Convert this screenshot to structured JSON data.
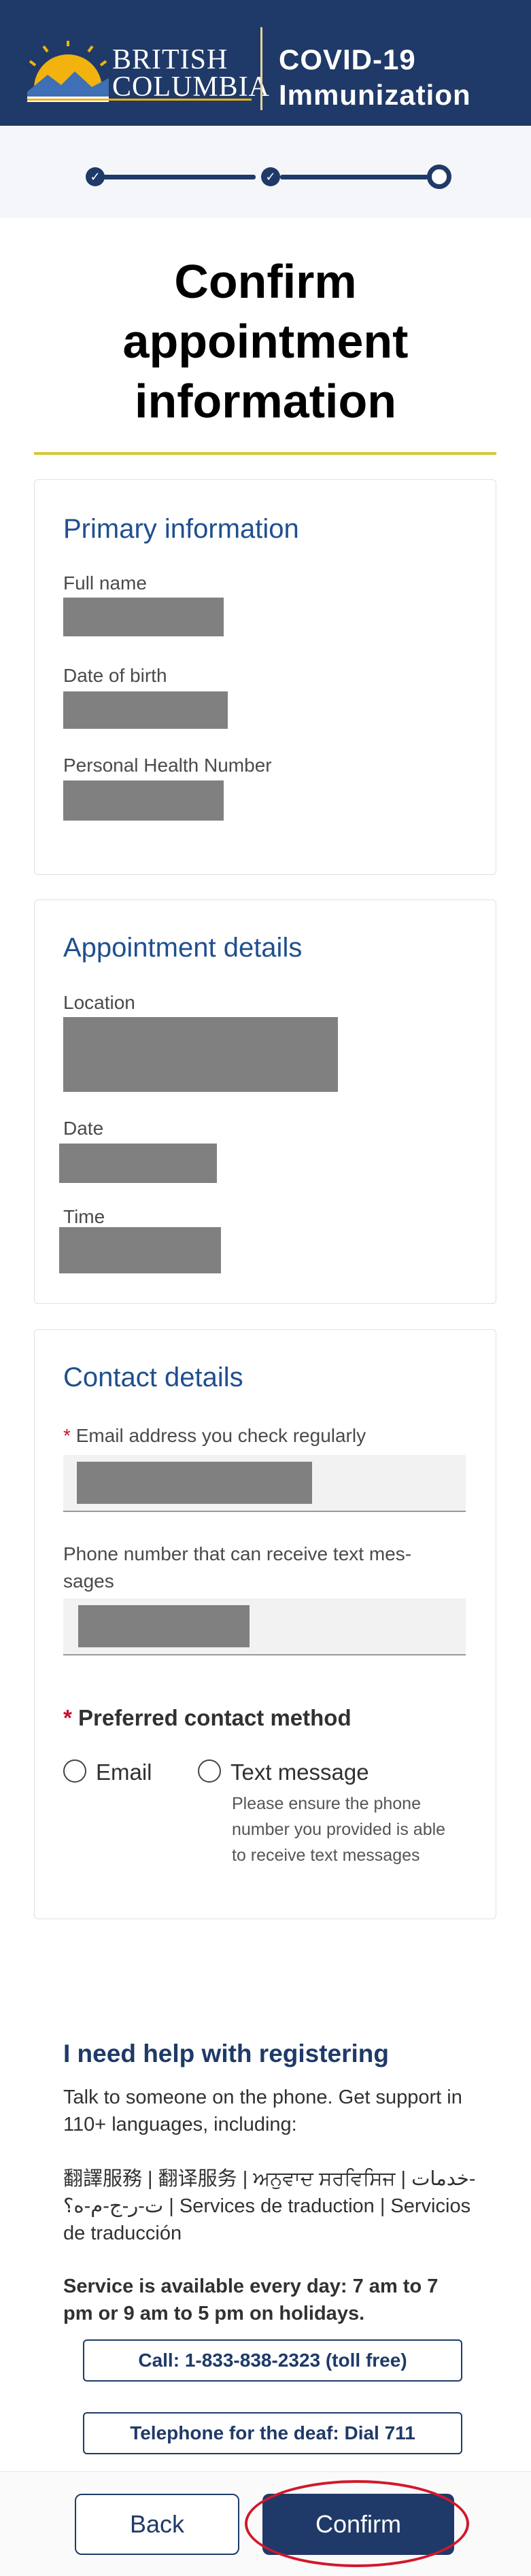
{
  "header": {
    "logo_line1": "BRITISH",
    "logo_line2": "COLUMBIA",
    "title_line1": "COVID-19",
    "title_line2": "Immunization"
  },
  "stepper": {
    "steps_total": 3,
    "current_step": 3,
    "done_icon": "check-icon"
  },
  "page": {
    "title_line1": "Confirm",
    "title_line2": "appointment",
    "title_line3": "information"
  },
  "primary": {
    "title": "Primary information",
    "full_name_label": "Full name",
    "dob_label": "Date of birth",
    "phn_label": "Personal Health Number"
  },
  "appointment": {
    "title": "Appointment details",
    "location_label": "Location",
    "date_label": "Date",
    "time_label": "Time"
  },
  "contact": {
    "title": "Contact details",
    "required_marker": "*",
    "email_label": "Email address you check regularly",
    "phone_label_line1": "Phone number that can receive text mes-",
    "phone_label_line2": "sages",
    "preferred_label": "Preferred contact method",
    "option_email": "Email",
    "option_text": "Text message",
    "text_hint_line1": "Please ensure the phone",
    "text_hint_line2": "number you provided is able",
    "text_hint_line3": "to receive text messages"
  },
  "help": {
    "title": "I need help with registering",
    "intro_line1": "Talk to someone on the phone. Get support in",
    "intro_line2": "110+ languages, including:",
    "languages_line1": "翻譯服務 | 翻译服务 | ਅਨੁਵਾਦ ਸਰਵਿਸਿਜ | خدمات-",
    "languages_line2": "ت-ر-ج-م-ه؟ | Services de traduction | Servicios",
    "languages_line3": "de traducción",
    "service_line1": "Service is available every day: 7 am to 7",
    "service_line2": "pm or 9 am to 5 pm on holidays.",
    "call_button": "Call: 1-833-838-2323 (toll free)",
    "deaf_button": "Telephone for the deaf: Dial 711"
  },
  "footer": {
    "back_button": "Back",
    "confirm_button": "Confirm"
  },
  "colors": {
    "brand_navy": "#1f3a68",
    "accent_gold": "#d6c636",
    "highlight_red": "#d1182b",
    "heading_blue": "#1f4f8f"
  }
}
